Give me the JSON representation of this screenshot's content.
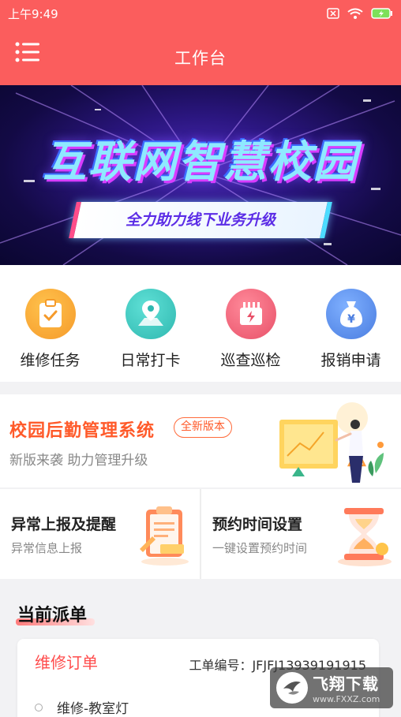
{
  "status_bar": {
    "time": "上午9:49",
    "icons": [
      "sim-icon",
      "wifi-icon",
      "battery-charging-icon"
    ]
  },
  "header": {
    "title": "工作台",
    "menu_icon": "menu-icon"
  },
  "banner": {
    "title": "互联网智慧校园",
    "subtitle": "全力助力线下业务升级"
  },
  "quick_actions": [
    {
      "label": "维修任务",
      "icon": "clipboard-check-icon",
      "color": "#f7a93a"
    },
    {
      "label": "日常打卡",
      "icon": "map-pin-icon",
      "color": "#3ec7c0"
    },
    {
      "label": "巡查巡检",
      "icon": "inspection-icon",
      "color": "#f0607a"
    },
    {
      "label": "报销申请",
      "icon": "money-bag-icon",
      "color": "#5a8de8"
    }
  ],
  "promo": {
    "title": "校园后勤管理系统",
    "badge": "全新版本",
    "subtitle": "新版来袭 助力管理升级"
  },
  "feature_cards": [
    {
      "title": "异常上报及提醒",
      "subtitle": "异常信息上报"
    },
    {
      "title": "预约时间设置",
      "subtitle": "一键设置预约时间"
    }
  ],
  "dispatch": {
    "section_title": "当前派单",
    "order": {
      "type": "维修订单",
      "number_label": "工单编号：JFJFJ13939191915",
      "item": "维修-教室灯"
    }
  },
  "watermark": {
    "brand": "飞翔下载",
    "url": "www.FXXZ.com"
  }
}
